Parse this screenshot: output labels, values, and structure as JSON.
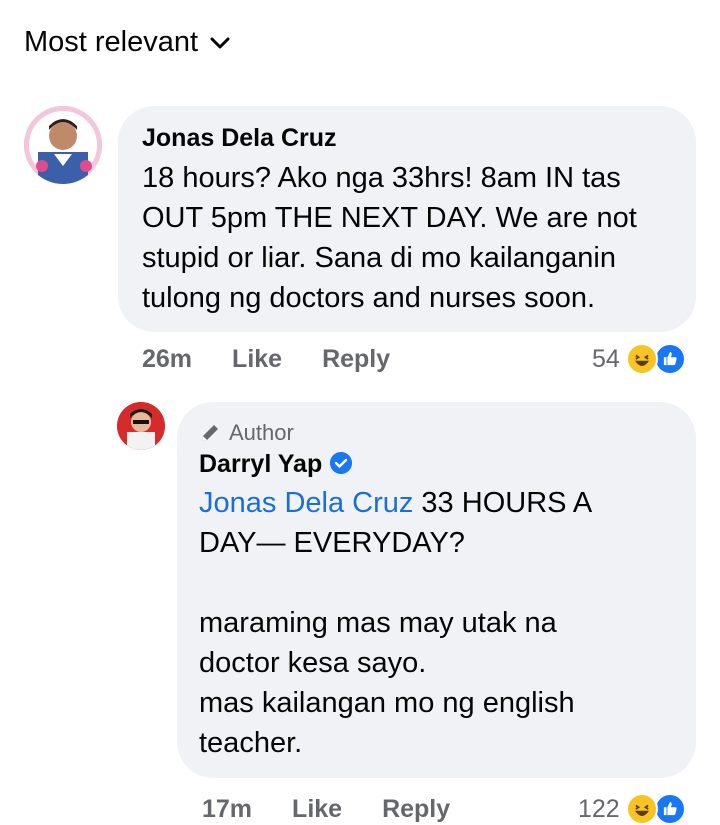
{
  "sort": {
    "label": "Most relevant"
  },
  "comments": [
    {
      "author": "Jonas Dela Cruz",
      "text": "18 hours? Ako nga 33hrs! 8am IN tas\nOUT 5pm THE NEXT DAY. We are not\nstupid or liar. Sana di mo kailanganin\ntulong ng doctors and nurses soon.",
      "time": "26m",
      "like_label": "Like",
      "reply_label": "Reply",
      "reaction_count": "54"
    }
  ],
  "reply": {
    "badge": "Author",
    "author": "Darryl Yap",
    "mention": "Jonas Dela Cruz",
    "text_first": " 33 HOURS A\nDAY— EVERYDAY?\n\nmaraming mas may utak na\ndoctor kesa sayo.\nmas kailangan mo ng english\nteacher.",
    "time": "17m",
    "like_label": "Like",
    "reply_label": "Reply",
    "reaction_count": "122"
  },
  "colors": {
    "bubble": "#f0f2f5",
    "meta": "#65676b",
    "mention": "#1a6ed8",
    "like_blue": "#1877f2",
    "haha_yellow": "#f7c325"
  }
}
